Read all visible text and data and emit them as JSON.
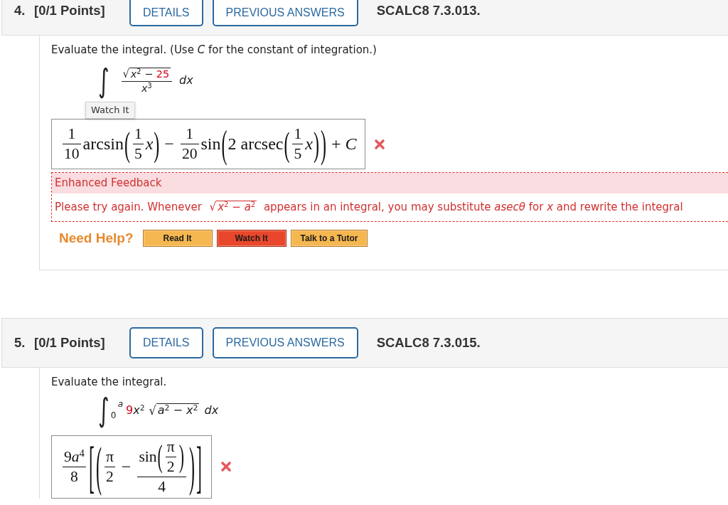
{
  "problems": [
    {
      "number": "4.",
      "points": "[0/1 Points]",
      "buttons": [
        "DETAILS",
        "PREVIOUS ANSWERS"
      ],
      "code": "SCALC8 7.3.013.",
      "prompt": "Evaluate the integral. (Use *C* for the constant of integration.)",
      "integral": {
        "sign": "∫",
        "integrand": [
          {
            "kind": "frac",
            "num": [
              {
                "kind": "sqrt",
                "sign": "√",
                "body": [
                  {
                    "kind": "text",
                    "text": "*x*$^{2}$ − "
                  },
                  {
                    "kind": "text",
                    "text": "25",
                    "color": "#d0021b"
                  }
                ]
              }
            ],
            "den": [
              {
                "kind": "text",
                "text": "*x*$^{3}$"
              }
            ]
          },
          {
            "kind": "var",
            "text": "dx"
          }
        ]
      },
      "tooltip": "Watch It",
      "answer": {
        "correct": false,
        "value": [
          {
            "kind": "frac",
            "num": [
              {
                "kind": "text",
                "text": "1"
              }
            ],
            "den": [
              {
                "kind": "text",
                "text": "10"
              }
            ]
          },
          {
            "kind": "text",
            "text": "arcsin"
          },
          {
            "kind": "paren",
            "open": "(",
            "close": ")",
            "body": [
              {
                "kind": "frac",
                "num": [
                  {
                    "kind": "text",
                    "text": "1"
                  }
                ],
                "den": [
                  {
                    "kind": "text",
                    "text": "5"
                  }
                ]
              },
              {
                "kind": "var",
                "text": "x"
              }
            ]
          },
          {
            "kind": "text",
            "text": " − "
          },
          {
            "kind": "frac",
            "num": [
              {
                "kind": "text",
                "text": "1"
              }
            ],
            "den": [
              {
                "kind": "text",
                "text": "20"
              }
            ]
          },
          {
            "kind": "text",
            "text": "sin"
          },
          {
            "kind": "paren",
            "open": "(",
            "close": ")",
            "body": [
              {
                "kind": "text",
                "text": "2 arcsec"
              },
              {
                "kind": "paren",
                "open": "(",
                "close": ")",
                "body": [
                  {
                    "kind": "frac",
                    "num": [
                      {
                        "kind": "text",
                        "text": "1"
                      }
                    ],
                    "den": [
                      {
                        "kind": "text",
                        "text": "5"
                      }
                    ]
                  },
                  {
                    "kind": "var",
                    "text": "x"
                  }
                ]
              }
            ]
          },
          {
            "kind": "text",
            "text": " + "
          },
          {
            "kind": "var",
            "text": "C"
          }
        ]
      },
      "feedback": {
        "title": "Enhanced Feedback",
        "text": [
          {
            "kind": "text",
            "text": "Please try again. Whenever "
          },
          {
            "kind": "sqrt",
            "sign": "√",
            "body": [
              {
                "kind": "text",
                "text": "*x*$^{2}$ − *a*$^{2}$"
              }
            ]
          },
          {
            "kind": "text",
            "text": "  appears in an integral, you may substitute *asecθ* for *x* and rewrite the integral"
          }
        ]
      },
      "help": {
        "label": "Need Help?",
        "buttons": [
          {
            "label": "Read It",
            "highlighted": false
          },
          {
            "label": "Watch It",
            "highlighted": true
          },
          {
            "label": "Talk to a Tutor",
            "highlighted": false
          }
        ]
      }
    },
    {
      "number": "5.",
      "points": "[0/1 Points]",
      "buttons": [
        "DETAILS",
        "PREVIOUS ANSWERS"
      ],
      "code": "SCALC8 7.3.015.",
      "prompt": "Evaluate the integral.",
      "integral": {
        "sign": "∫",
        "upper": [
          {
            "kind": "var",
            "text": "a"
          }
        ],
        "lower": [
          {
            "kind": "text",
            "text": "0"
          }
        ],
        "integrand": [
          {
            "kind": "text",
            "text": "9",
            "color": "#d0021b"
          },
          {
            "kind": "text",
            "text": "*x*$^{2}$"
          },
          {
            "kind": "sqrt",
            "sign": "√",
            "body": [
              {
                "kind": "text",
                "text": "*a*$^{2}$ − *x*$^{2}$"
              }
            ]
          },
          {
            "kind": "var",
            "text": "dx"
          }
        ]
      },
      "answer": {
        "correct": false,
        "value": [
          {
            "kind": "frac",
            "num": [
              {
                "kind": "text",
                "text": "9"
              },
              {
                "kind": "text",
                "text": "*a*$^{4}$"
              }
            ],
            "den": [
              {
                "kind": "text",
                "text": "8"
              }
            ]
          },
          {
            "kind": "paren",
            "open": "[",
            "close": "]",
            "body": [
              {
                "kind": "paren",
                "open": "(",
                "close": ")",
                "body": [
                  {
                    "kind": "frac",
                    "num": [
                      {
                        "kind": "text",
                        "text": "π"
                      }
                    ],
                    "den": [
                      {
                        "kind": "text",
                        "text": "2"
                      }
                    ]
                  },
                  {
                    "kind": "text",
                    "text": " − "
                  },
                  {
                    "kind": "frac",
                    "num": [
                      {
                        "kind": "text",
                        "text": "sin"
                      },
                      {
                        "kind": "paren",
                        "open": "(",
                        "close": ")",
                        "body": [
                          {
                            "kind": "frac",
                            "num": [
                              {
                                "kind": "text",
                                "text": "π"
                              }
                            ],
                            "den": [
                              {
                                "kind": "text",
                                "text": "2"
                              }
                            ]
                          }
                        ]
                      }
                    ],
                    "den": [
                      {
                        "kind": "text",
                        "text": "4"
                      }
                    ]
                  }
                ]
              }
            ]
          }
        ]
      }
    }
  ]
}
